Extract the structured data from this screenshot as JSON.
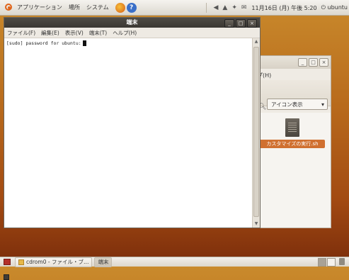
{
  "top_panel": {
    "menus": [
      "アプリケーション",
      "場所",
      "システム"
    ],
    "clock": "11月16日 (月) 午後 5:20",
    "user": "ubuntu"
  },
  "terminal": {
    "title": "端末",
    "menus": [
      "ファイル(F)",
      "編集(E)",
      "表示(V)",
      "端末(T)",
      "ヘルプ(H)"
    ],
    "line": "[sudo] password for ubuntu:",
    "window_buttons": [
      "_",
      "□",
      "×"
    ]
  },
  "file_manager": {
    "menu_help": "プ(H)",
    "view_mode": "アイコン表示",
    "file_label": "カスタマイズの実行.sh",
    "window_buttons": [
      "_",
      "□",
      "×"
    ]
  },
  "taskbar": {
    "tasks": [
      "cdrom0 - ファイル・ブ…",
      "端末"
    ]
  }
}
